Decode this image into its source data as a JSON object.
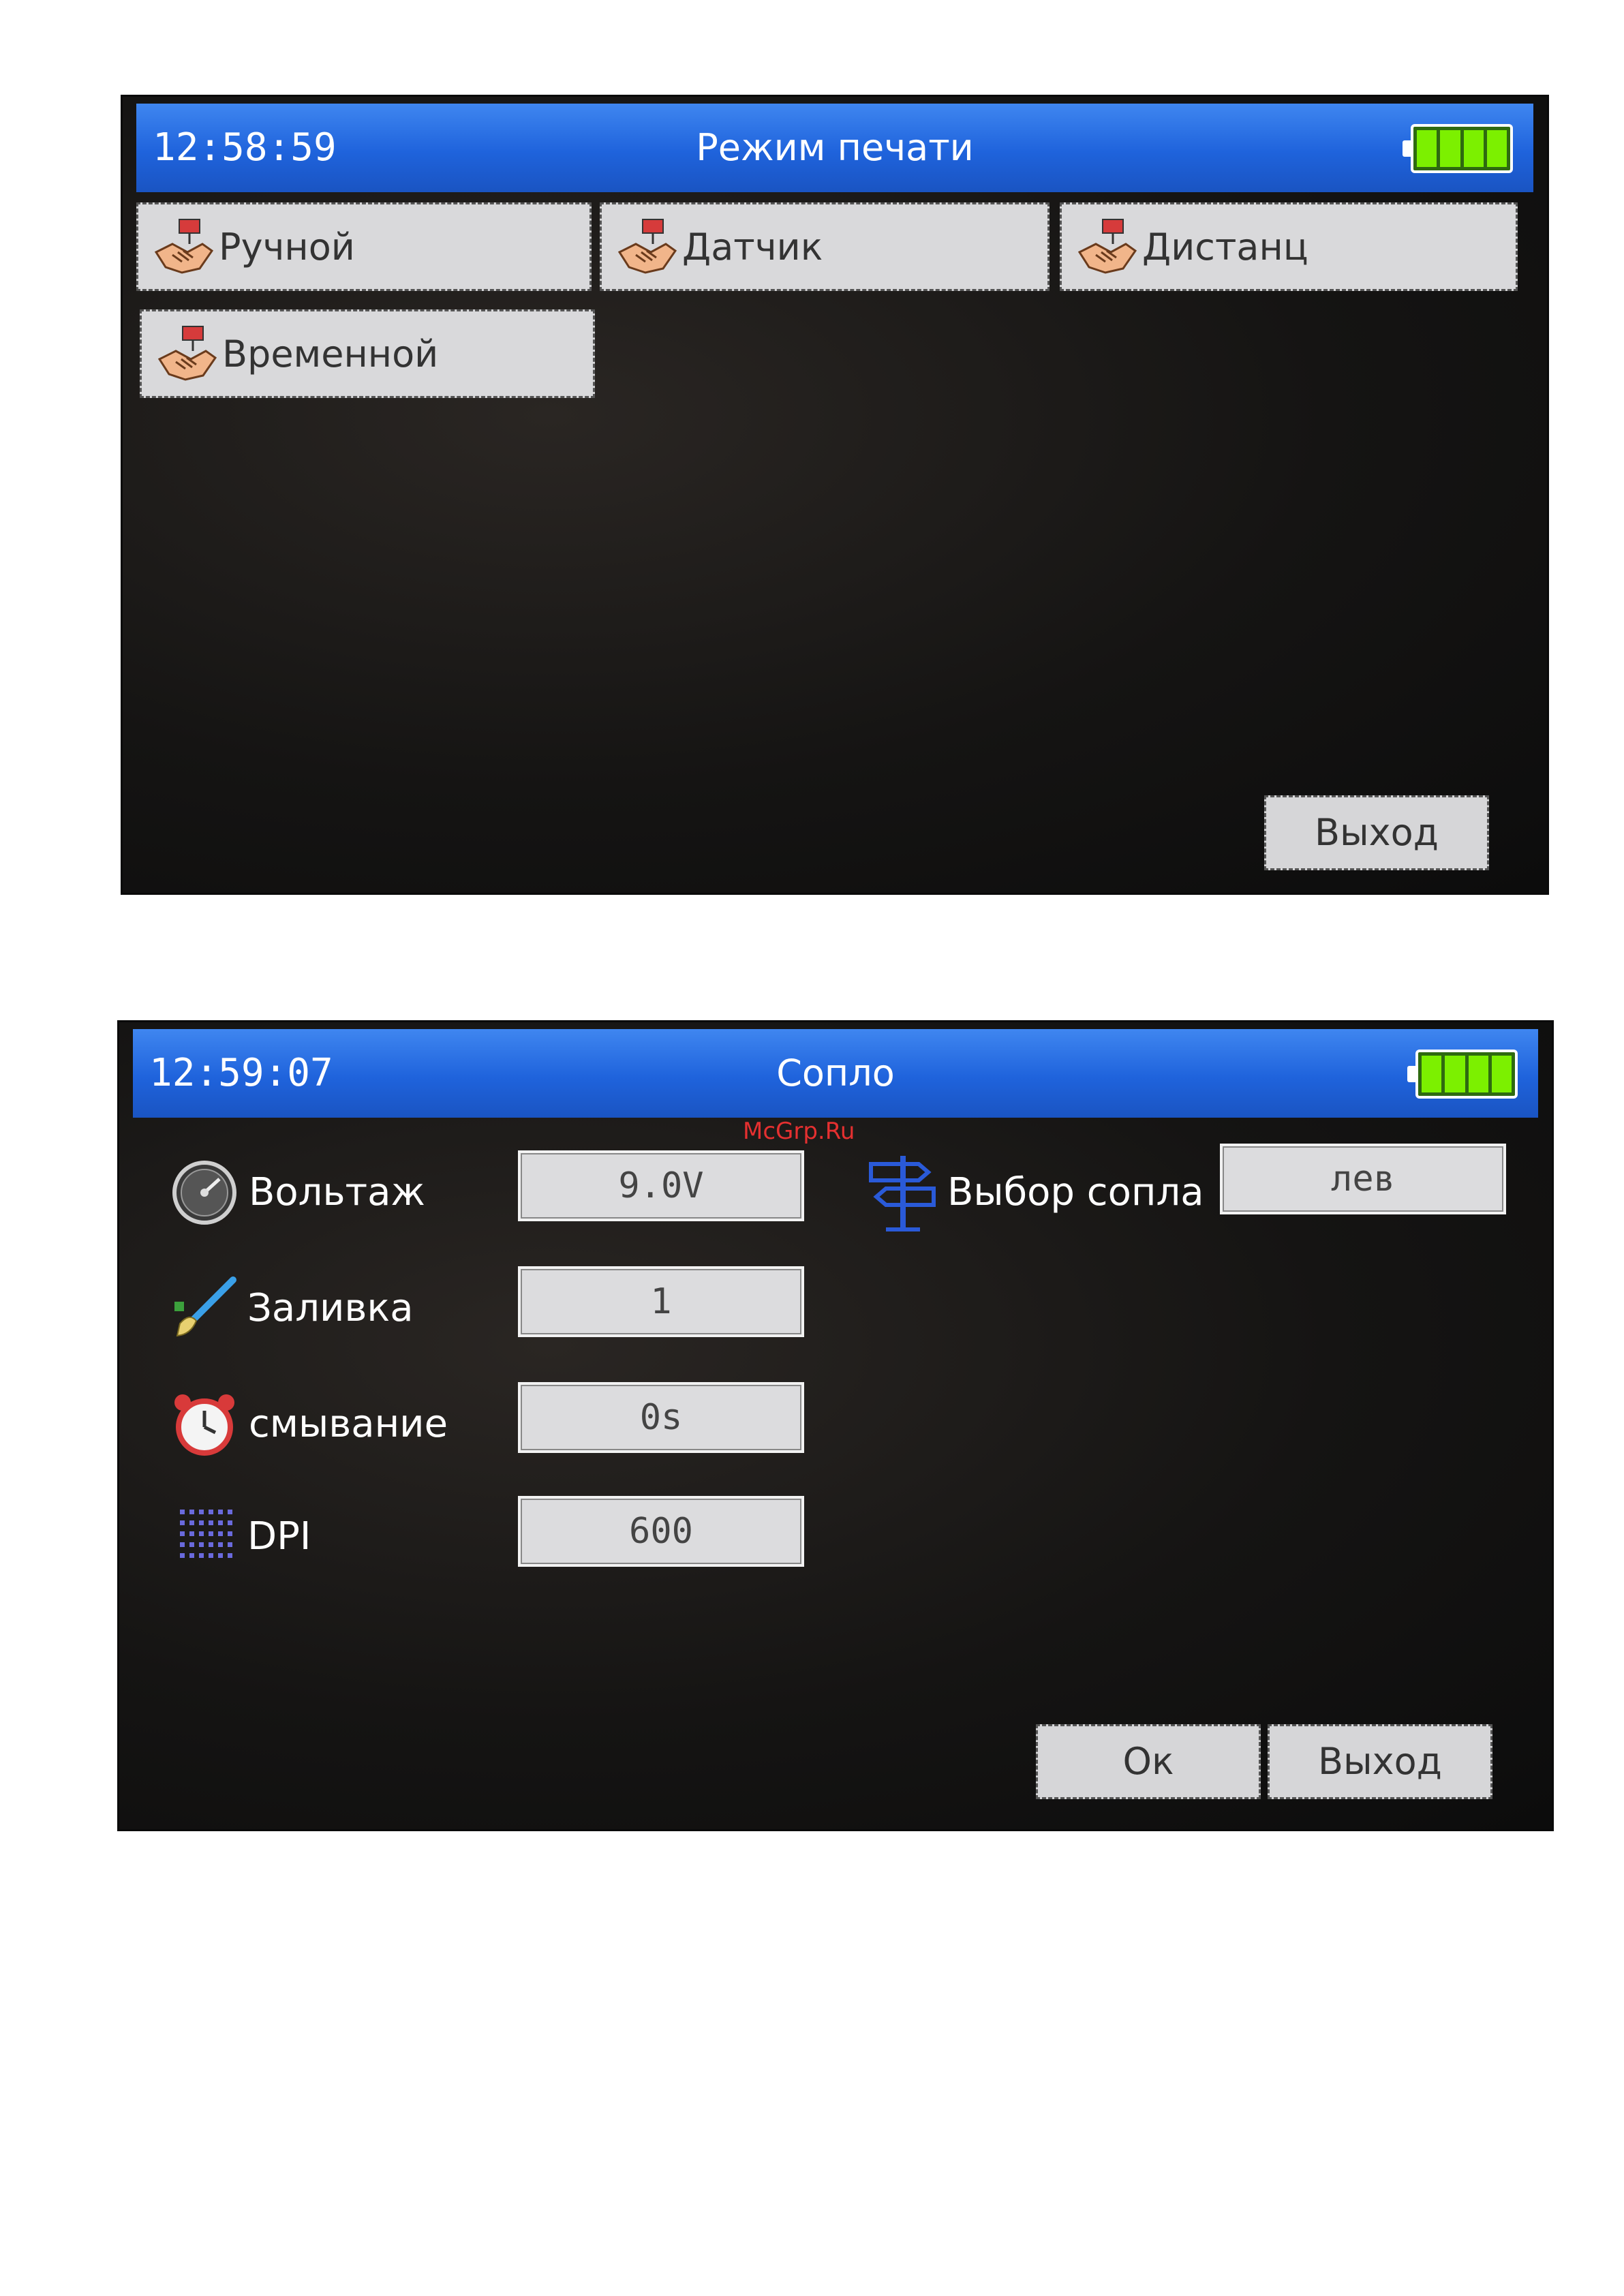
{
  "screen1": {
    "time": "12:58:59",
    "title": "Режим печати",
    "tiles": [
      "Ручной",
      "Датчик",
      "Дистанц",
      "Временной"
    ],
    "exit_label": "Выход"
  },
  "screen2": {
    "time": "12:59:07",
    "title": "Сопло",
    "rows": [
      {
        "label": "Вольтаж",
        "value": "9.0V"
      },
      {
        "label": "Заливка",
        "value": "1"
      },
      {
        "label": "смывание",
        "value": "0s"
      },
      {
        "label": "DPI",
        "value": "600"
      }
    ],
    "nozzle_label": "Выбор сопла",
    "nozzle_value": "лев",
    "ok_label": "Ок",
    "exit_label": "Выход"
  },
  "watermark": "McGrp.Ru",
  "colors": {
    "titlebar": "#1f63dc",
    "battery_fill": "#7cf000",
    "tile_bg": "#d9d9db",
    "screen_bg": "#151413"
  }
}
